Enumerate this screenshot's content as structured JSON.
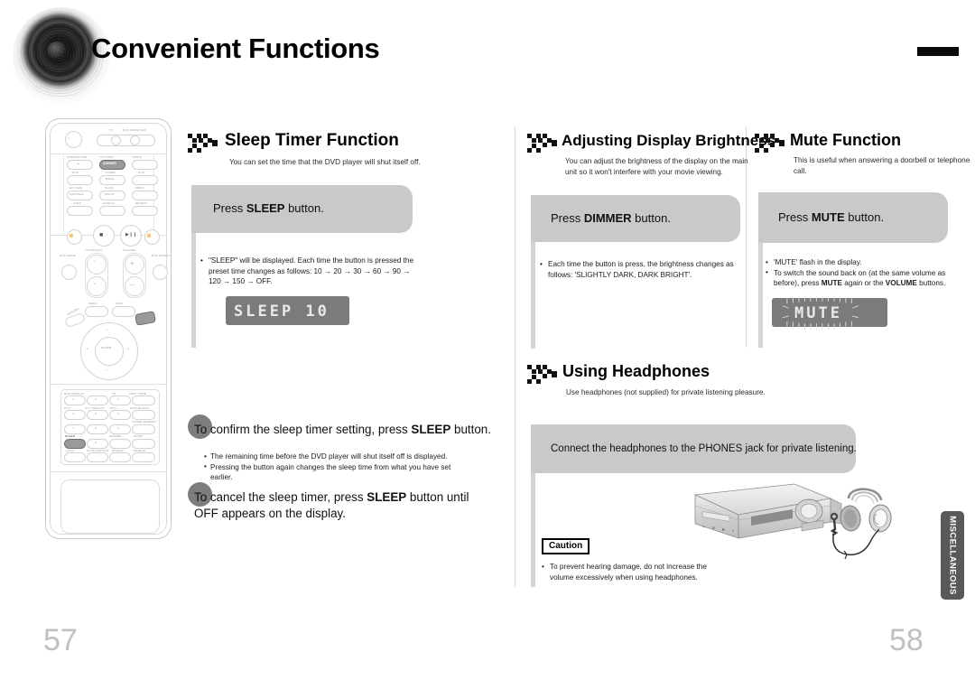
{
  "header": {
    "title": "Convenient Functions",
    "disc_icon": "disc-graphic",
    "corner_bar": "black-corner-bar"
  },
  "remote": {
    "name": "remote-control-illustration",
    "highlighted_buttons": [
      "DIMMER",
      "SLEEP"
    ],
    "labels": {
      "power": "POWER",
      "tv": "TV",
      "dvd_receiver": "DVD RECEIVER",
      "open_close": "OPEN/CLOSE",
      "tv_video": "TV/VIDEO",
      "mode": "MODE",
      "dvd": "DVD",
      "tuner": "TUNER",
      "aux": "AUX",
      "band": "BAND",
      "ex_view": "EX.VIEW",
      "slow": "SLOW",
      "menu": "MENU",
      "original": "ORIGINAL",
      "mo_st": "MO/ST",
      "step": "STEP",
      "cancel": "CANCEL",
      "repeat": "REPEAT",
      "tuning_ch": "TUNING/CH",
      "volume": "VOLUME",
      "dsp_mode": "DSP MODE",
      "dsp_effect": "DSP EFFECT",
      "return": "RETURN",
      "info": "INFO",
      "enter": "ENTER",
      "rds_display": "RDS DISPLAY",
      "ta": "TA",
      "pty_minus": "PTY-",
      "pty_search": "PTY SEARCH",
      "pty_plus": "PTY+",
      "sound_edit": "SOUND EDIT",
      "test_tone": "TEST TONE",
      "tuner_memory": "TUNER MEMORY",
      "sleep": "SLEEP",
      "dimmer": "DIMMER",
      "zoom": "ZOOM",
      "logo": "LOGO",
      "slow_motion": "SLOW MOTION",
      "digest": "DIGEST",
      "remain": "REMAIN"
    }
  },
  "sections": {
    "sleep_timer": {
      "title": "Sleep Timer Function",
      "subtitle": "You can set the time that the DVD player will shut itself off.",
      "banner_prefix": "Press ",
      "banner_strong": "SLEEP",
      "banner_suffix": " button.",
      "bullets": [
        "\"SLEEP\" will be displayed. Each time the button is pressed the preset time changes as follows: 10 → 20 → 30 → 60 → 90 → 120 → 150 → OFF."
      ],
      "lcd_text": "SLEEP  10",
      "steps": [
        {
          "pre": "To confirm the sleep timer setting, press ",
          "strong": "SLEEP",
          "post": " button.",
          "notes": [
            "The remaining time before the DVD player will shut itself off is displayed.",
            "Pressing the button again changes the sleep time from what you have set earlier."
          ]
        },
        {
          "pre": "To cancel the sleep timer, press ",
          "strong": "SLEEP",
          "post": " button until OFF appears on the display.",
          "notes": []
        }
      ]
    },
    "display_brightness": {
      "title": "Adjusting Display Brightness",
      "subtitle": "You can adjust the brightness of the display on the main unit so it won't interfere with your movie viewing.",
      "banner_prefix": "Press ",
      "banner_strong": "DIMMER",
      "banner_suffix": " button.",
      "bullets": [
        "Each time the button is press, the brightness changes as follows: 'SLIGHTLY DARK, DARK  BRIGHT'."
      ]
    },
    "mute": {
      "title": "Mute Function",
      "subtitle": "This is useful when answering a doorbell or telephone call.",
      "banner_prefix": "Press ",
      "banner_strong": "MUTE",
      "banner_suffix": " button.",
      "bullet_1": "'MUTE' flash in the display.",
      "bullet_2_a": "To switch the sound back on (at the same volume as before), press ",
      "bullet_2_b": "MUTE",
      "bullet_2_c": " again or the ",
      "bullet_2_d": "VOLUME",
      "bullet_2_e": " buttons.",
      "lcd_text": "MUTE"
    },
    "headphones": {
      "title": "Using Headphones",
      "subtitle": "Use headphones (not supplied) for private listening pleasure.",
      "banner_text": "Connect the headphones to the PHONES jack for private listening.",
      "caution_label": "Caution",
      "caution_bullets": [
        "To prevent hearing damage, do not increase the volume excessively when using headphones."
      ],
      "illustration": "dvd-player-with-headphones"
    }
  },
  "side_tab": {
    "label": "MISCELLANEOUS"
  },
  "page_numbers": {
    "left": "57",
    "right": "58"
  },
  "colors": {
    "banner_gray": "#c9c9c9",
    "lcd_gray": "#7b7b7b",
    "side_tab_gray": "#595959",
    "page_number_gray": "#c0c0c0",
    "step_dot_gray": "#7d7d7d"
  }
}
